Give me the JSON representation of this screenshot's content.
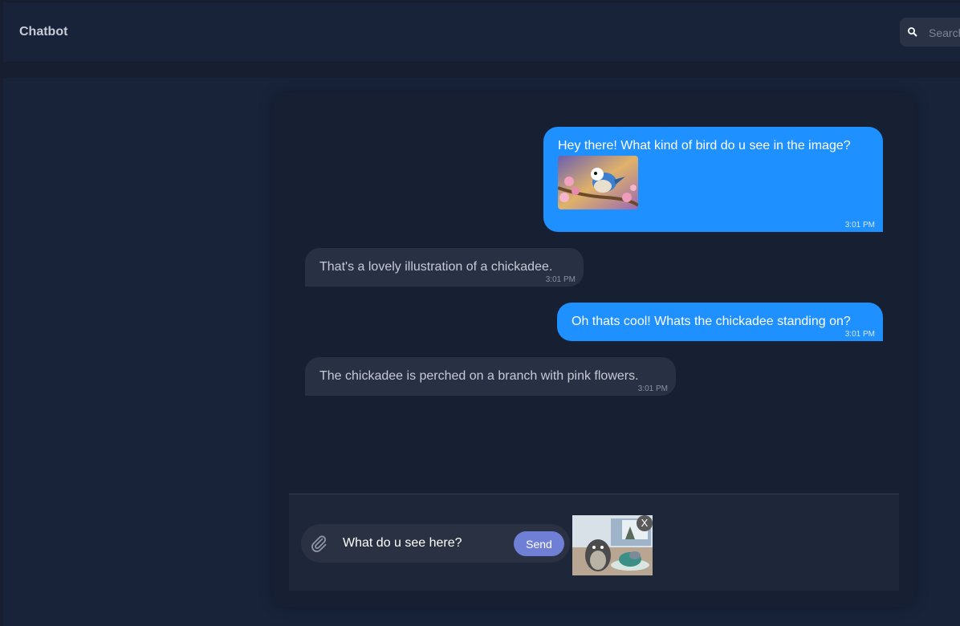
{
  "header": {
    "title": "Chatbot",
    "search_placeholder": "Search"
  },
  "messages": [
    {
      "sender": "user",
      "text": "Hey there! What kind of bird do u see in the image?",
      "time": "3:01 PM",
      "has_image": true
    },
    {
      "sender": "bot",
      "text": "That's a lovely illustration of a chickadee.",
      "time": "3:01 PM"
    },
    {
      "sender": "user",
      "text": "Oh thats cool! Whats the chickadee standing on?",
      "time": "3:01 PM"
    },
    {
      "sender": "bot",
      "text": "The chickadee is perched on a branch with pink flowers.",
      "time": "3:01 PM"
    }
  ],
  "composer": {
    "input_value": "What do u see here?",
    "send_label": "Send",
    "remove_label": "X"
  },
  "colors": {
    "user_bubble": "#1e90ff",
    "bot_bubble": "#283044",
    "send_button": "#6f7fd6"
  },
  "icons": {
    "search": "search-icon",
    "attach": "paperclip-icon"
  }
}
